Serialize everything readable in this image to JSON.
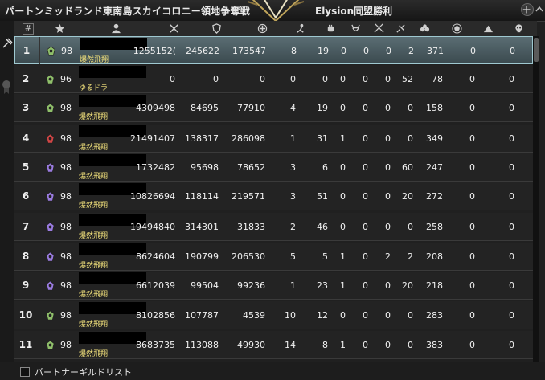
{
  "window": {
    "title": "パートンミッドランド東南島スカイコロニー領地争奪戦",
    "result": "Elysion同盟勝利"
  },
  "header": {
    "hash": "#",
    "icons": [
      "star-icon",
      "person-icon",
      "swords-icon",
      "shield-icon",
      "heal-cross-icon",
      "kneeling-icon",
      "fist-icon",
      "demon-icon",
      "crossed-blades-icon",
      "broken-sword-icon",
      "hands-icon",
      "sun-emblem-icon",
      "camp-icon",
      "skull-icon"
    ]
  },
  "rows": [
    {
      "rank": "1",
      "level": "98",
      "guild": "爆然飛翔",
      "v": [
        "1255152(",
        "245622",
        "173547",
        "8",
        "19",
        "0",
        "0",
        "0",
        "2",
        "371",
        "0",
        "0"
      ],
      "selected": true,
      "classColor": "#8fbf6a"
    },
    {
      "rank": "2",
      "level": "96",
      "guild": "ゆるドラ",
      "v": [
        "0",
        "0",
        "0",
        "0",
        "0",
        "0",
        "0",
        "0",
        "52",
        "78",
        "0",
        "0"
      ],
      "selected": false,
      "classColor": "#8fbf6a"
    },
    {
      "rank": "3",
      "level": "98",
      "guild": "爆然飛翔",
      "v": [
        "4309498",
        "84695",
        "77910",
        "4",
        "19",
        "0",
        "0",
        "0",
        "0",
        "158",
        "0",
        "0"
      ],
      "selected": false,
      "classColor": "#8fbf6a"
    },
    {
      "rank": "4",
      "level": "98",
      "guild": "爆然飛翔",
      "v": [
        "21491407",
        "138317",
        "286098",
        "1",
        "31",
        "1",
        "0",
        "0",
        "0",
        "349",
        "0",
        "0"
      ],
      "selected": false,
      "classColor": "#d04545"
    },
    {
      "rank": "5",
      "level": "98",
      "guild": "爆然飛翔",
      "v": [
        "1732482",
        "95698",
        "78652",
        "3",
        "6",
        "0",
        "0",
        "0",
        "60",
        "247",
        "0",
        "0"
      ],
      "selected": false,
      "classColor": "#9a7be0"
    },
    {
      "rank": "6",
      "level": "98",
      "guild": "爆然飛翔",
      "v": [
        "10826694",
        "118114",
        "219571",
        "3",
        "51",
        "0",
        "0",
        "0",
        "20",
        "272",
        "0",
        "0"
      ],
      "selected": false,
      "classColor": "#9a7be0"
    },
    {
      "rank": "7",
      "level": "98",
      "guild": "爆然飛翔",
      "v": [
        "19494840",
        "314301",
        "31833",
        "2",
        "46",
        "0",
        "0",
        "0",
        "0",
        "258",
        "0",
        "0"
      ],
      "selected": false,
      "classColor": "#9a7be0"
    },
    {
      "rank": "8",
      "level": "98",
      "guild": "爆然飛翔",
      "v": [
        "8624604",
        "190799",
        "206530",
        "5",
        "5",
        "1",
        "0",
        "2",
        "2",
        "208",
        "0",
        "0"
      ],
      "selected": false,
      "classColor": "#9a7be0"
    },
    {
      "rank": "9",
      "level": "98",
      "guild": "爆然飛翔",
      "v": [
        "6612039",
        "99504",
        "99236",
        "1",
        "23",
        "1",
        "0",
        "0",
        "20",
        "218",
        "0",
        "0"
      ],
      "selected": false,
      "classColor": "#9a7be0"
    },
    {
      "rank": "10",
      "level": "98",
      "guild": "爆然飛翔",
      "v": [
        "8102856",
        "107787",
        "4539",
        "10",
        "12",
        "0",
        "0",
        "0",
        "0",
        "283",
        "0",
        "0"
      ],
      "selected": false,
      "classColor": "#8fbf6a"
    },
    {
      "rank": "11",
      "level": "98",
      "guild": "爆然飛翔",
      "v": [
        "8683735",
        "113088",
        "49930",
        "14",
        "8",
        "1",
        "0",
        "0",
        "0",
        "383",
        "0",
        "0"
      ],
      "selected": false,
      "classColor": "#8fbf6a"
    }
  ],
  "footer": {
    "partner_list_label": "パートナーギルドリスト"
  }
}
